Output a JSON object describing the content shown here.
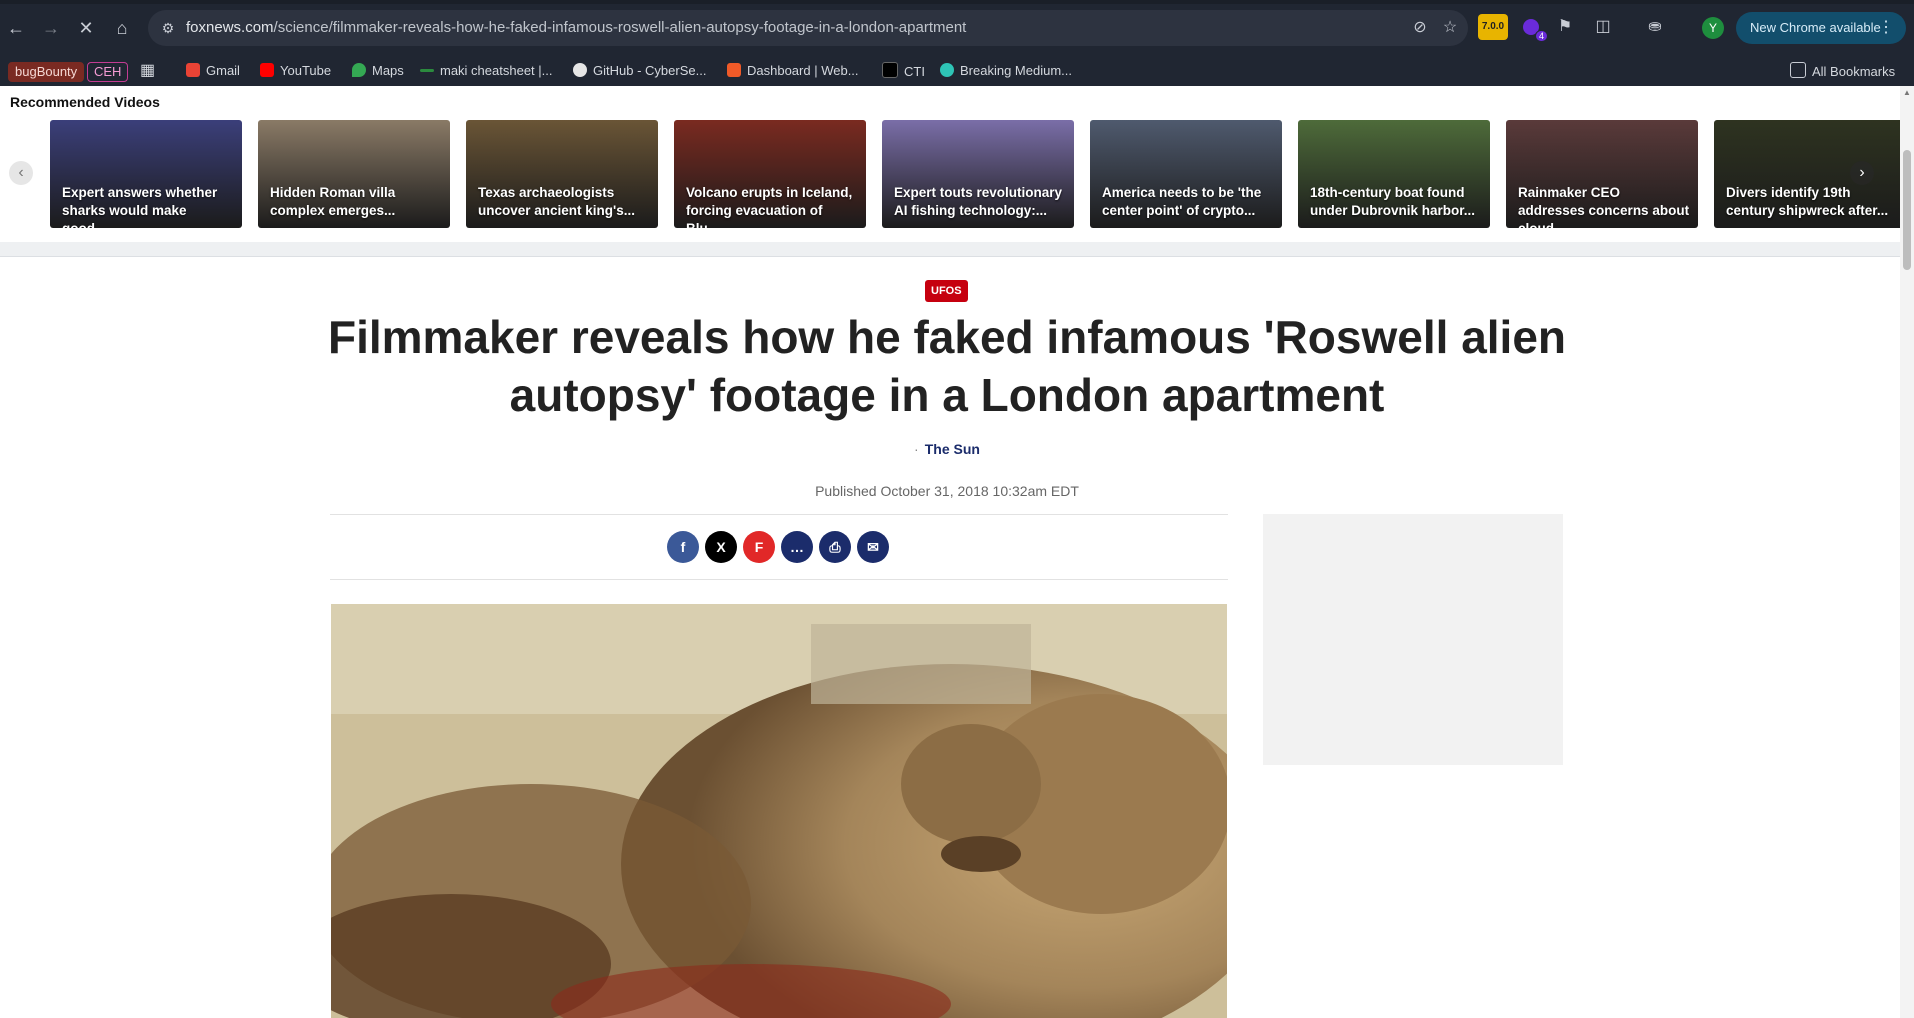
{
  "browser": {
    "url_host": "foxnews.com",
    "url_path": "/science/filmmaker-reveals-how-he-faked-infamous-roswell-alien-autopsy-footage-in-a-london-apartment",
    "ext_badge_version": "7.0.0",
    "ext_badge_count": "4",
    "profile_initial": "Y",
    "update_label": "New Chrome available",
    "icons": [
      "back-icon",
      "forward-icon",
      "stop-icon",
      "home-icon",
      "site-info-icon",
      "eye-off-icon",
      "star-icon",
      "extensions-icon",
      "kebab-icon"
    ]
  },
  "bookmarks": {
    "items": [
      {
        "label": "bugBounty"
      },
      {
        "label": "CEH"
      },
      {
        "label": "Gmail"
      },
      {
        "label": "YouTube"
      },
      {
        "label": "Maps"
      },
      {
        "label": "maki cheatsheet |..."
      },
      {
        "label": "GitHub - CyberSe..."
      },
      {
        "label": "Dashboard | Web..."
      },
      {
        "label": "CTI"
      },
      {
        "label": "Breaking Medium..."
      }
    ],
    "all_bookmarks": "All Bookmarks"
  },
  "recommended": {
    "title": "Recommended Videos",
    "videos": [
      {
        "caption": "Expert answers whether sharks would make good...",
        "color": "#3b3f7a"
      },
      {
        "caption": "Hidden Roman villa complex emerges...",
        "color": "#8a7a66"
      },
      {
        "caption": "Texas archaeologists uncover ancient king's...",
        "color": "#6a5536"
      },
      {
        "caption": "Volcano erupts in Iceland, forcing evacuation of Blu...",
        "color": "#7a2a20"
      },
      {
        "caption": "Expert touts revolutionary AI fishing technology:...",
        "color": "#7a6ea8"
      },
      {
        "caption": "America needs to be 'the center point' of crypto...",
        "color": "#4f5a6e"
      },
      {
        "caption": "18th-century boat found under Dubrovnik harbor...",
        "color": "#4e6b3a"
      },
      {
        "caption": "Rainmaker CEO addresses concerns about cloud...",
        "color": "#5a3a3a"
      },
      {
        "caption": "Divers identify 19th century shipwreck after...",
        "color": "#2e3320"
      }
    ]
  },
  "article": {
    "category": "UFOS",
    "headline": "Filmmaker reveals how he faked infamous 'Roswell alien autopsy' footage in a London apartment",
    "source": "The Sun",
    "published": "Published October 31, 2018 10:32am EDT"
  },
  "share": {
    "buttons": [
      {
        "label": "f",
        "color": "#3b5998"
      },
      {
        "label": "X",
        "color": "#000000"
      },
      {
        "label": "F",
        "color": "#e12828"
      },
      {
        "label": "…",
        "color": "#1b2c6b"
      },
      {
        "label": "⎙",
        "color": "#1b2c6b"
      },
      {
        "label": "✉",
        "color": "#1b2c6b"
      }
    ]
  },
  "colors": {
    "chrome_bg": "#202632",
    "fox_red": "#c6000f",
    "fox_navy": "#1b2c6b"
  }
}
